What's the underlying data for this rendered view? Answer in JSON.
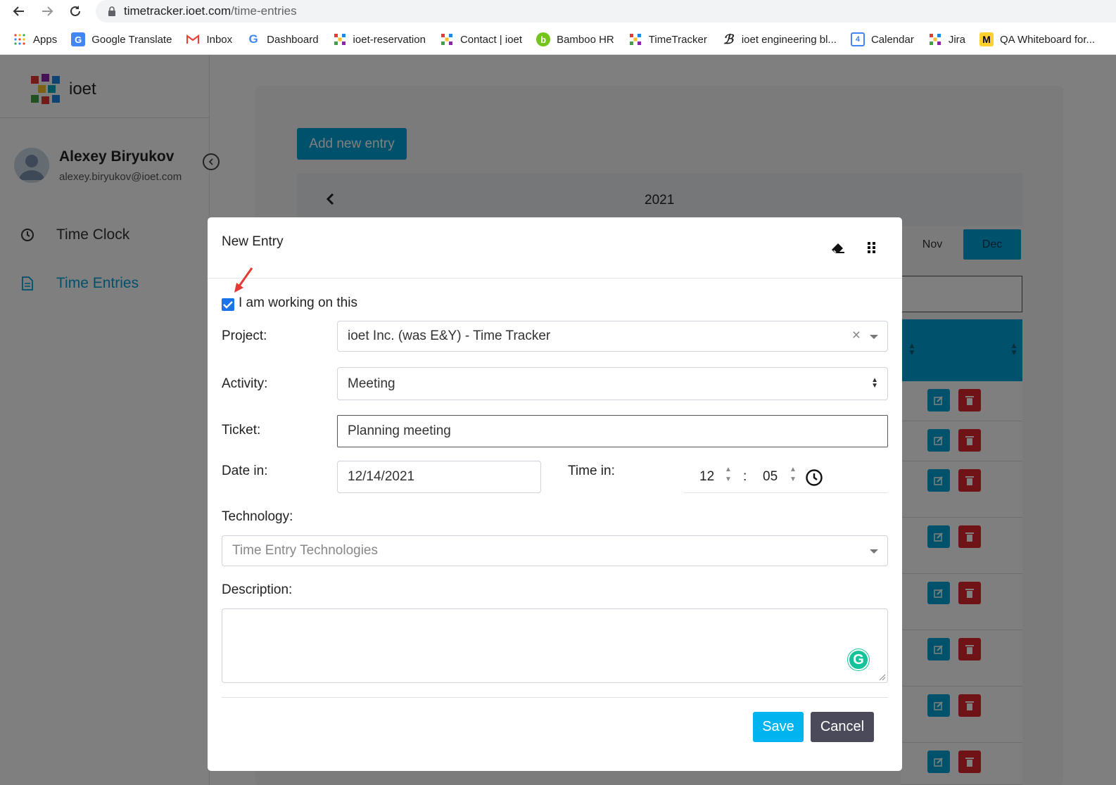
{
  "browser": {
    "url_host": "timetracker.ioet.com",
    "url_path": "/time-entries",
    "bookmarks": [
      {
        "label": "Apps",
        "icon": "apps-grid-icon"
      },
      {
        "label": "Google Translate",
        "icon": "google-translate-icon"
      },
      {
        "label": "Inbox",
        "icon": "gmail-icon"
      },
      {
        "label": "Dashboard",
        "icon": "google-icon"
      },
      {
        "label": "ioet-reservation",
        "icon": "ioet-icon"
      },
      {
        "label": "Contact | ioet",
        "icon": "ioet-icon"
      },
      {
        "label": "Bamboo HR",
        "icon": "bamboo-hr-icon"
      },
      {
        "label": "TimeTracker",
        "icon": "ioet-icon"
      },
      {
        "label": "ioet engineering bl...",
        "icon": "ioet-engineering-icon"
      },
      {
        "label": "Calendar",
        "icon": "google-calendar-icon"
      },
      {
        "label": "Jira",
        "icon": "ioet-icon"
      },
      {
        "label": "QA Whiteboard for...",
        "icon": "miro-icon"
      }
    ]
  },
  "sidebar": {
    "logo_text": "ioet",
    "user_name": "Alexey Biryukov",
    "user_email": "alexey.biryukov@ioet.com",
    "menu": [
      {
        "label": "Time Clock",
        "icon": "clock-icon",
        "active": false
      },
      {
        "label": "Time Entries",
        "icon": "document-icon",
        "active": true
      }
    ]
  },
  "main": {
    "add_button": "Add new entry",
    "year": "2021",
    "months_visible": [
      "Nov",
      "Dec"
    ],
    "selected_month": "Dec"
  },
  "modal": {
    "title": "New Entry",
    "working_on_this": {
      "label": "I am working on this",
      "checked": true
    },
    "project": {
      "label": "Project:",
      "value": "ioet Inc. (was E&Y) - Time Tracker"
    },
    "activity": {
      "label": "Activity:",
      "value": "Meeting"
    },
    "ticket": {
      "label": "Ticket:",
      "value": "Planning meeting"
    },
    "date_in": {
      "label": "Date in:",
      "value": "12/14/2021"
    },
    "time_in": {
      "label": "Time in:",
      "hours": "12",
      "minutes": "05",
      "separator": ":"
    },
    "technology": {
      "label": "Technology:",
      "placeholder": "Time Entry Technologies"
    },
    "description": {
      "label": "Description:",
      "value": ""
    },
    "save_label": "Save",
    "cancel_label": "Cancel"
  },
  "colors": {
    "accent": "#00a3d9",
    "delete": "#e0262f",
    "cancel": "#4a4a5a",
    "annotation_arrow": "#e53935"
  }
}
